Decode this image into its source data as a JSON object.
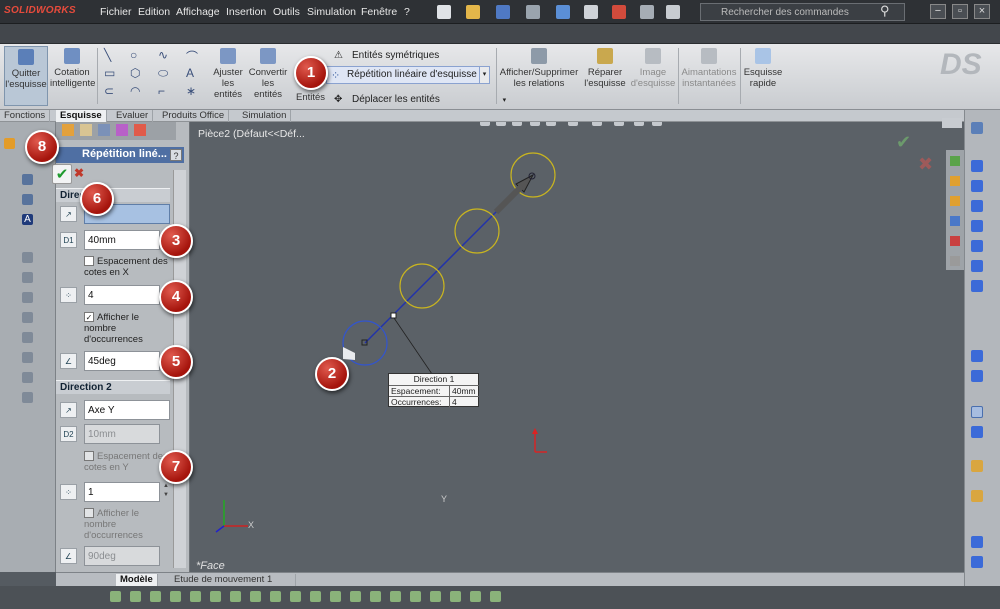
{
  "app": {
    "logo": "SOLIDWORKS"
  },
  "menu": {
    "items": [
      "Fichier",
      "Edition",
      "Affichage",
      "Insertion",
      "Outils",
      "Simulation",
      "Fenêtre",
      "?"
    ]
  },
  "search": {
    "placeholder": "Rechercher des commandes"
  },
  "ribbon": {
    "quit_sketch": "Quitter l'esquisse",
    "smart_dim": "Cotation intelligente",
    "trim": "Ajuster les entités",
    "convert": "Convertir les entités",
    "offset": "Entités",
    "mirror": "Entités symétriques",
    "linear_pattern": "Répétition linéaire d'esquisse",
    "move": "Déplacer les entités",
    "show_relations": "Afficher/Supprimer les relations",
    "repair": "Réparer l'esquisse",
    "sketch_picture": "Image d'esquisse",
    "snaps": "Aimantations instantanées",
    "rapid_sketch": "Esquisse rapide"
  },
  "tabs": [
    "Fonctions",
    "Esquisse",
    "Evaluer",
    "Produits Office",
    "Simulation"
  ],
  "active_tab": "Esquisse",
  "property_manager": {
    "title": "Répétition liné...",
    "help": "?",
    "direction1": {
      "header": "Direc",
      "spacing": "40mm",
      "dimension_x_label": "Espacement des cotes en X",
      "count": "4",
      "show_count_label": "Afficher le nombre d'occurrences",
      "angle": "45deg"
    },
    "direction2": {
      "header": "Direction 2",
      "axis": "Axe Y",
      "spacing": "10mm",
      "dimension_y_label": "Espacement des cotes en Y",
      "count": "1",
      "show_count_label": "Afficher le nombre d'occurrences",
      "angle": "90deg"
    }
  },
  "viewport": {
    "part": "Pièce2  (Défaut<<Déf...",
    "face_label": "*Face",
    "dim_box": {
      "title": "Direction 1",
      "rows": [
        {
          "label": "Espacement:",
          "value": "40mm"
        },
        {
          "label": "Occurrences:",
          "value": "4"
        }
      ]
    },
    "axis_x": "X",
    "axis_y": "Y"
  },
  "bottom_tabs": [
    "Modèle",
    "Etude de mouvement 1"
  ],
  "callouts": [
    "1",
    "2",
    "3",
    "4",
    "5",
    "6",
    "7",
    "8"
  ],
  "colors": {
    "accent": "#4f6fa3",
    "callout": "#b5221a",
    "pattern_circle": "#c8b420",
    "seed_circle": "#3355cc"
  }
}
